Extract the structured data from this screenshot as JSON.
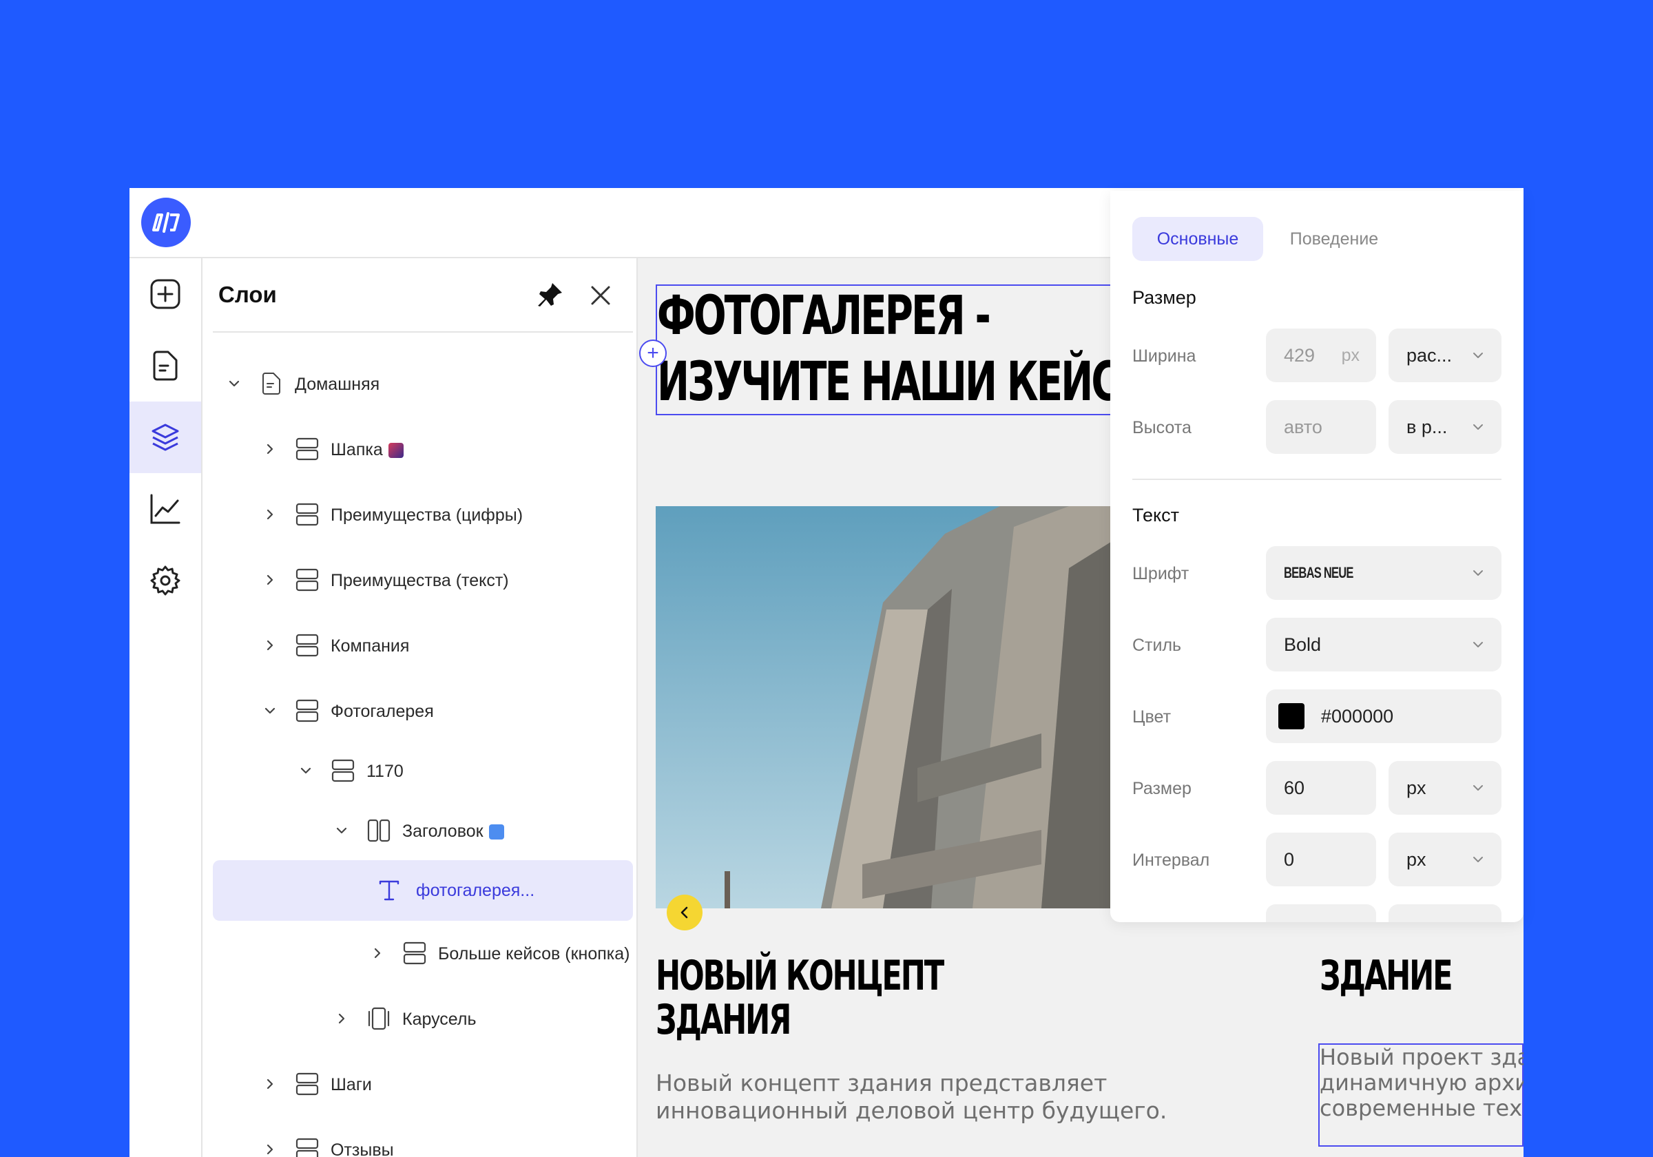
{
  "rail": {
    "items": [
      {
        "name": "add"
      },
      {
        "name": "pages"
      },
      {
        "name": "layers"
      },
      {
        "name": "analytics"
      },
      {
        "name": "settings"
      }
    ]
  },
  "layers": {
    "title": "Слои",
    "items": [
      {
        "label": "Домашняя"
      },
      {
        "label": "Шапка"
      },
      {
        "label": "Преимущества (цифры)"
      },
      {
        "label": "Преимущества (текст)"
      },
      {
        "label": "Компания"
      },
      {
        "label": "Фотогалерея"
      },
      {
        "label": "1170"
      },
      {
        "label": "Заголовок"
      },
      {
        "label": "фотогалерея..."
      },
      {
        "label": "Больше кейсов (кнопка)"
      },
      {
        "label": "Карусель"
      },
      {
        "label": "Шаги"
      },
      {
        "label": "Отзывы"
      }
    ]
  },
  "canvas": {
    "heading_line1": "ФОТОГАЛЕРЕЯ -",
    "heading_line2": "ИЗУЧИТЕ НАШИ КЕЙСЫ",
    "card1_title_line1": "НОВЫЙ КОНЦЕПТ",
    "card1_title_line2": "ЗДАНИЯ",
    "card1_text": "Новый концепт здания представляет инновационный деловой центр будущего.",
    "card2_title": "ЗДАНИЕ",
    "card2_text": "Новый проект здания сочетает динамичную архитектуру и современные технологии."
  },
  "props": {
    "tab_main": "Основные",
    "tab_behavior": "Поведение",
    "size_section": "Размер",
    "width_label": "Ширина",
    "width_value": "429",
    "width_unit": "px",
    "width_mode": "рас...",
    "height_label": "Высота",
    "height_value": "авто",
    "height_mode": "в р...",
    "text_section": "Текст",
    "font_label": "Шрифт",
    "font_value": "BEBAS NEUE",
    "style_label": "Стиль",
    "style_value": "Bold",
    "color_label": "Цвет",
    "color_value": "#000000",
    "fontsize_label": "Размер",
    "fontsize_value": "60",
    "fontsize_unit": "px",
    "spacing_label": "Интервал",
    "spacing_value": "0",
    "spacing_unit": "px"
  },
  "colors": {
    "background": "#1f5aff",
    "accent": "#3a3adc",
    "selection": "#e8e8fc",
    "carousel_button": "#f5d632"
  }
}
